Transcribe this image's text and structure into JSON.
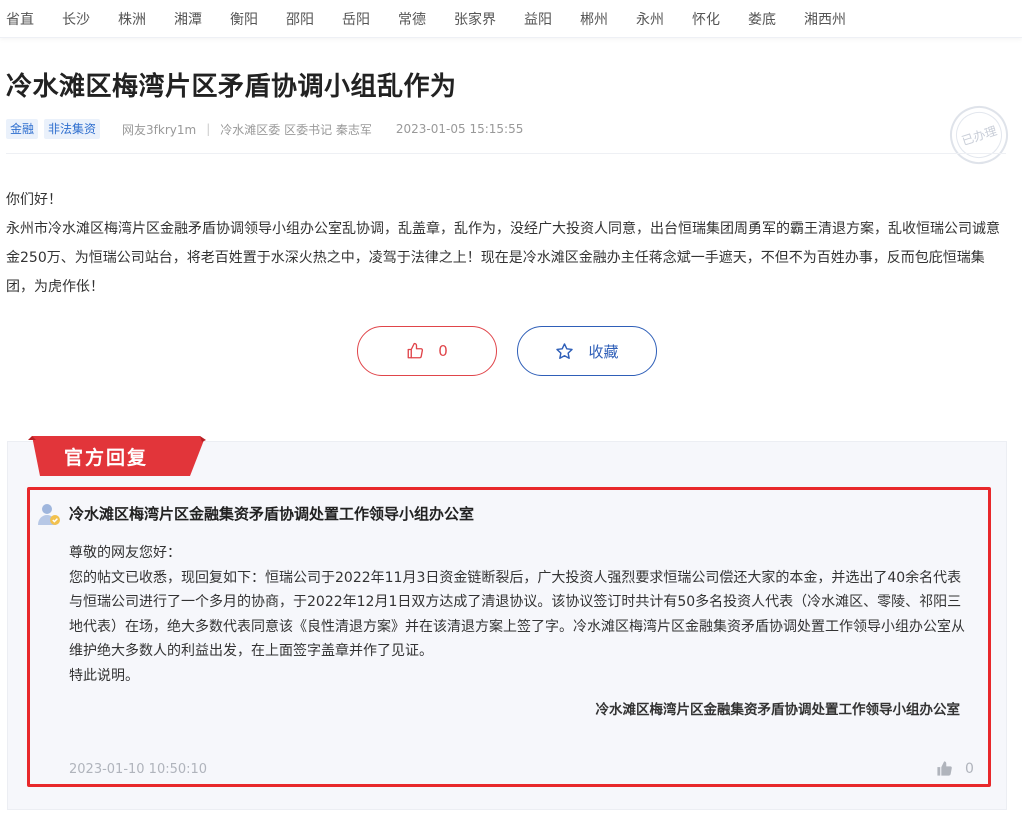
{
  "nav": {
    "items": [
      "省直",
      "长沙",
      "株洲",
      "湘潭",
      "衡阳",
      "邵阳",
      "岳阳",
      "常德",
      "张家界",
      "益阳",
      "郴州",
      "永州",
      "怀化",
      "娄底",
      "湘西州"
    ]
  },
  "post": {
    "title": "冷水滩区梅湾片区矛盾协调小组乱作为",
    "tags": [
      "金融",
      "非法集资"
    ],
    "author": "网友3fkry1m",
    "department": "冷水滩区委 区委书记 秦志军",
    "time": "2023-01-05 15:15:55",
    "stamp_text": "已办理",
    "body": [
      "你们好！",
      "永州市冷水滩区梅湾片区金融矛盾协调领导小组办公室乱协调，乱盖章，乱作为，没经广大投资人同意，出台恒瑞集团周勇军的霸王清退方案，乱收恒瑞公司诚意金250万、为恒瑞公司站台，将老百姓置于水深火热之中，凌驾于法律之上！现在是冷水滩区金融办主任蒋念斌一手遮天，不但不为百姓办事，反而包庇恒瑞集团，为虎作伥！"
    ]
  },
  "actions": {
    "like_count": "0",
    "favorite_label": "收藏"
  },
  "reply": {
    "ribbon_label": "官方回复",
    "department": "冷水滩区梅湾片区金融集资矛盾协调处置工作领导小组办公室",
    "paragraphs": [
      "尊敬的网友您好：",
      "您的帖文已收悉，现回复如下：恒瑞公司于2022年11月3日资金链断裂后，广大投资人强烈要求恒瑞公司偿还大家的本金，并选出了40余名代表与恒瑞公司进行了一个多月的协商，于2022年12月1日双方达成了清退协议。该协议签订时共计有50多名投资人代表（冷水滩区、零陵、祁阳三地代表）在场，绝大多数代表同意该《良性清退方案》并在该清退方案上签了字。冷水滩区梅湾片区金融集资矛盾协调处置工作领导小组办公室从维护绝大多数人的利益出发，在上面签字盖章并作了见证。",
      "特此说明。"
    ],
    "signature": "冷水滩区梅湾片区金融集资矛盾协调处置工作领导小组办公室",
    "time": "2023-01-10 10:50:10",
    "like_count": "0"
  },
  "colors": {
    "accent_red": "#e0454a",
    "accent_blue": "#2f5fb8",
    "ribbon_red": "#e2353a",
    "highlight_border": "#e8282b"
  }
}
